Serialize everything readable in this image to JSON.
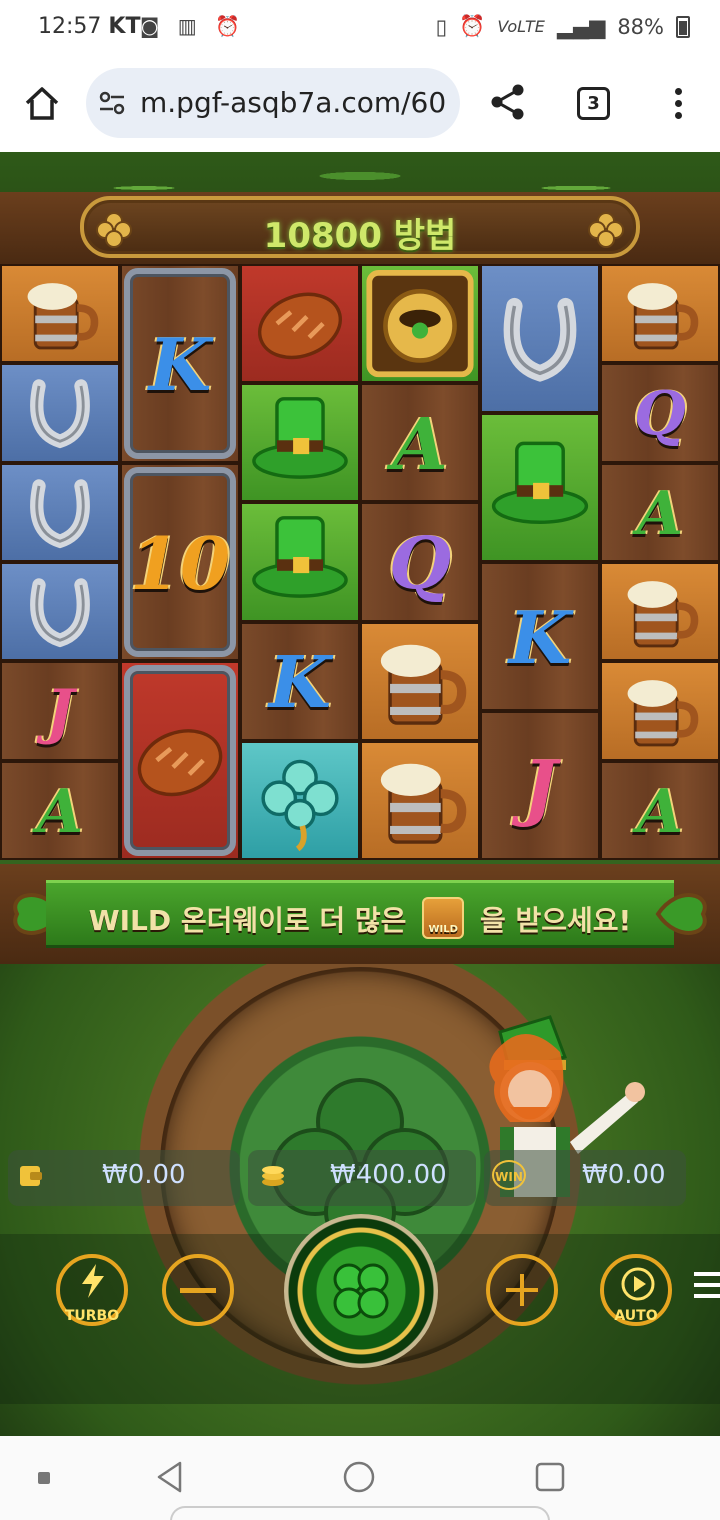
{
  "status_bar": {
    "time": "12:57",
    "carrier": "KT",
    "battery": "88%",
    "network_label": "VoLTE"
  },
  "browser": {
    "url": "m.pgf-asqb7a.com/60",
    "tab_count": "3"
  },
  "game": {
    "ways_label": "10800 방법",
    "banner_text_before": "WILD 온더웨이로 더 많은",
    "banner_badge": "WILD",
    "banner_text_after": "을 받으세요!",
    "balance": "₩0.00",
    "bet": "₩400.00",
    "win": "₩0.00",
    "win_badge": "WIN",
    "turbo_label": "TURBO",
    "auto_label": "AUTO",
    "reels": [
      [
        "beer-mug",
        "horseshoe",
        "horseshoe",
        "horseshoe",
        "J",
        "A"
      ],
      [
        "K",
        "10",
        "bread"
      ],
      [
        "bread",
        "top-hat",
        "top-hat",
        "K",
        "clover"
      ],
      [
        "pot-of-gold",
        "A",
        "Q",
        "beer-mug",
        "beer-mug"
      ],
      [
        "horseshoe",
        "top-hat",
        "K",
        "J"
      ],
      [
        "beer-mug",
        "Q",
        "A",
        "beer-mug",
        "beer-mug",
        "A"
      ]
    ],
    "letter_symbols": {
      "K": "K",
      "Q": "Q",
      "J": "J",
      "A": "A",
      "10": "10"
    }
  },
  "colors": {
    "accent_gold": "#e6a520",
    "ways_text": "#cfe86a",
    "value_text": "#cfe0ff"
  }
}
